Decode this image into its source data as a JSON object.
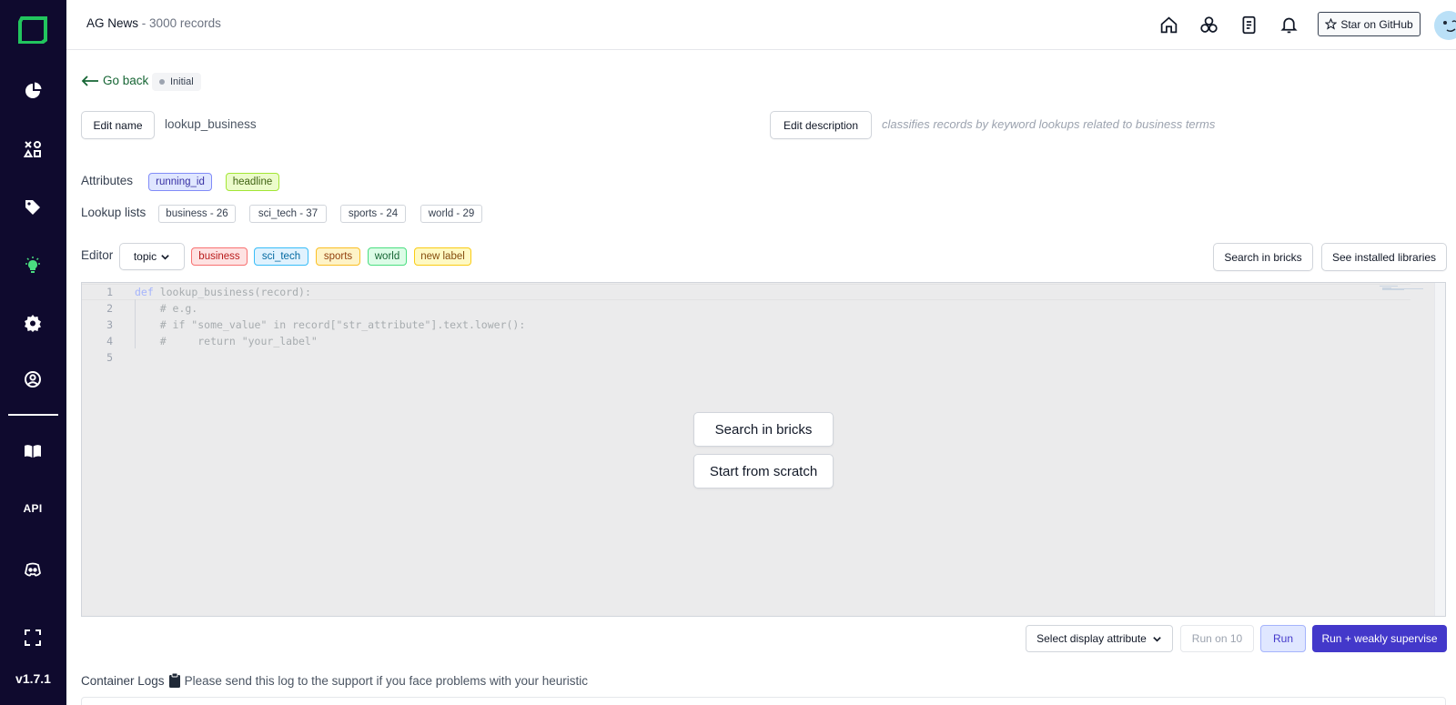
{
  "header": {
    "project_name": "AG News",
    "separator": "-",
    "record_count": "3000 records",
    "github_label": "Star on GitHub"
  },
  "sidebar": {
    "items": [
      "overview-icon",
      "data-browser-icon",
      "labeling-icon",
      "heuristics-icon",
      "settings-icon",
      "users-icon",
      "docs-icon",
      "api",
      "discord-icon",
      "fullscreen-icon"
    ],
    "api_label": "API",
    "version": "v1.7.1"
  },
  "page": {
    "go_back": "Go back",
    "state": "Initial",
    "edit_name_button": "Edit name",
    "name": "lookup_business",
    "edit_description_button": "Edit description",
    "description": "classifies records by keyword lookups related to business terms"
  },
  "attributes": {
    "label": "Attributes",
    "items": [
      "running_id",
      "headline"
    ]
  },
  "lookup_lists": {
    "label": "Lookup lists",
    "items": [
      "business - 26",
      "sci_tech - 37",
      "sports - 24",
      "world - 29"
    ]
  },
  "editor": {
    "label": "Editor",
    "task": "topic",
    "labels": [
      "business",
      "sci_tech",
      "sports",
      "world",
      "new label"
    ],
    "search_bricks_button": "Search in bricks",
    "installed_libraries_button": "See installed libraries",
    "line_numbers": [
      "1",
      "2",
      "3",
      "4",
      "5"
    ],
    "code_keyword": "def",
    "code_lines": [
      " lookup_business(record):",
      "    # e.g.",
      "    # if \"some_value\" in record[\"str_attribute\"].text.lower():",
      "    #     return \"your_label\"",
      ""
    ],
    "overlay_search_bricks": "Search in bricks",
    "overlay_start_scratch": "Start from scratch"
  },
  "actions": {
    "select_display_attribute": "Select display attribute",
    "run_on_10": "Run on 10",
    "run": "Run",
    "run_weakly_supervise": "Run + weakly supervise"
  },
  "logs": {
    "label": "Container Logs",
    "hint": "Please send this log to the support if you face problems with your heuristic"
  },
  "colors": {
    "sidebar_bg": "#0f0a2e",
    "accent": "#4338ca",
    "logo_green": "#22c55e",
    "active_icon": "#4ade80"
  }
}
